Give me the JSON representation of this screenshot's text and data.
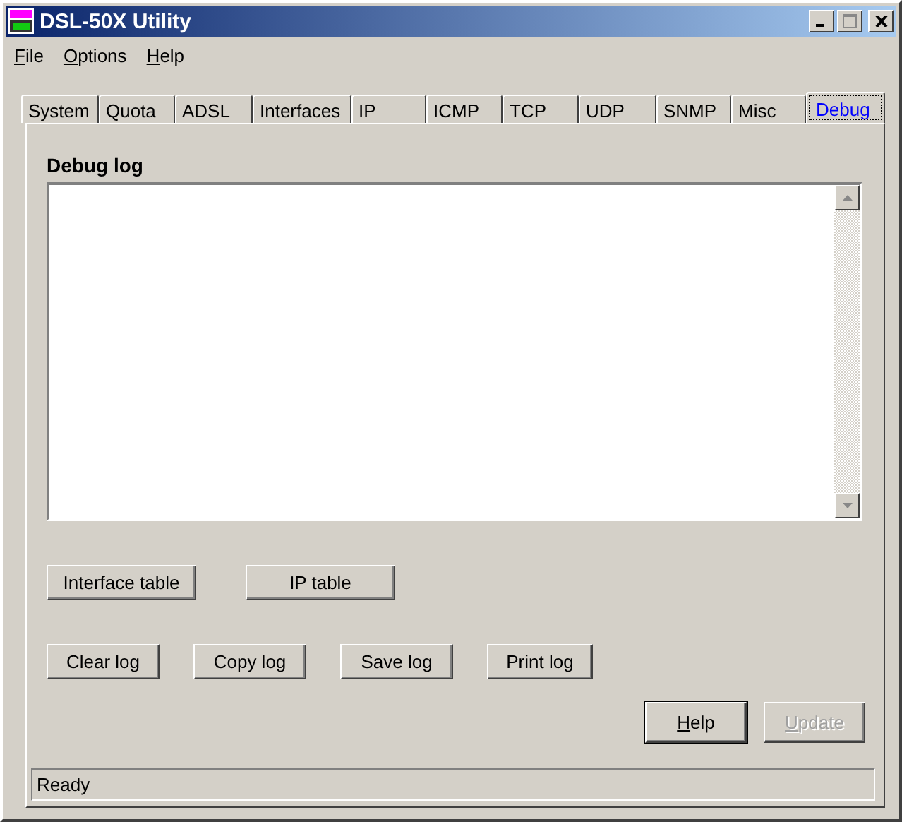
{
  "window": {
    "title": "DSL-50X Utility"
  },
  "menu": [
    "File",
    "Options",
    "Help"
  ],
  "tabs": [
    {
      "label": "System",
      "selected": false
    },
    {
      "label": "Quota",
      "selected": false
    },
    {
      "label": "ADSL",
      "selected": false
    },
    {
      "label": "Interfaces",
      "selected": false
    },
    {
      "label": "IP",
      "selected": false
    },
    {
      "label": "ICMP",
      "selected": false
    },
    {
      "label": "TCP",
      "selected": false
    },
    {
      "label": "UDP",
      "selected": false
    },
    {
      "label": "SNMP",
      "selected": false
    },
    {
      "label": "Misc",
      "selected": false
    },
    {
      "label": "Debug",
      "selected": true
    }
  ],
  "debug_log": {
    "label": "Debug log"
  },
  "table_buttons": [
    "Interface table",
    "IP table"
  ],
  "log_buttons": [
    "Clear log",
    "Copy log",
    "Save log",
    "Print log"
  ],
  "dialog_buttons": [
    {
      "label": "Help",
      "disabled": false,
      "default": true
    },
    {
      "label": "Update",
      "disabled": true,
      "default": false
    }
  ],
  "status_bar": "Ready"
}
